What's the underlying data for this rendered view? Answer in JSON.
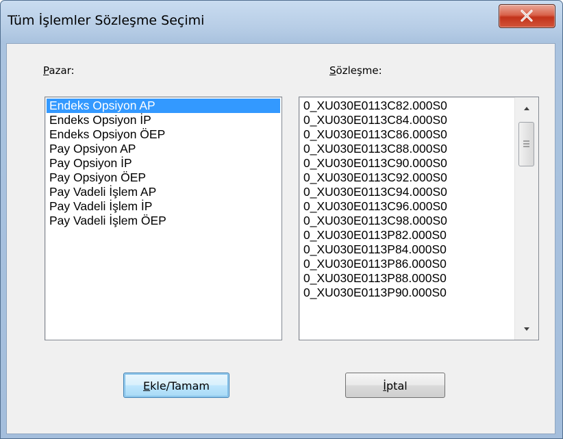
{
  "window": {
    "title": "Tüm İşlemler Sözleşme Seçimi",
    "close_icon": "close-x-icon"
  },
  "pazar": {
    "label_mnemonic": "P",
    "label_rest": "azar:",
    "items": [
      "Endeks Opsiyon AP",
      "Endeks Opsiyon İP",
      "Endeks Opsiyon ÖEP",
      "Pay Opsiyon AP",
      "Pay Opsiyon İP",
      "Pay Opsiyon ÖEP",
      "Pay Vadeli İşlem AP",
      "Pay Vadeli İşlem İP",
      "Pay Vadeli İşlem ÖEP"
    ],
    "selected_index": 0
  },
  "sozlesme": {
    "label_mnemonic": "S",
    "label_rest": "özleşme:",
    "items": [
      "0_XU030E0113C82.000S0",
      "0_XU030E0113C84.000S0",
      "0_XU030E0113C86.000S0",
      "0_XU030E0113C88.000S0",
      "0_XU030E0113C90.000S0",
      "0_XU030E0113C92.000S0",
      "0_XU030E0113C94.000S0",
      "0_XU030E0113C96.000S0",
      "0_XU030E0113C98.000S0",
      "0_XU030E0113P82.000S0",
      "0_XU030E0113P84.000S0",
      "0_XU030E0113P86.000S0",
      "0_XU030E0113P88.000S0",
      "0_XU030E0113P90.000S0"
    ]
  },
  "buttons": {
    "ok_mnemonic": "E",
    "ok_rest": "kle/Tamam",
    "cancel_mnemonic": "İ",
    "cancel_rest": "ptal"
  },
  "colors": {
    "selection": "#3399ff",
    "close_button": "#c2331a",
    "title_bar": "#b7cde6"
  }
}
